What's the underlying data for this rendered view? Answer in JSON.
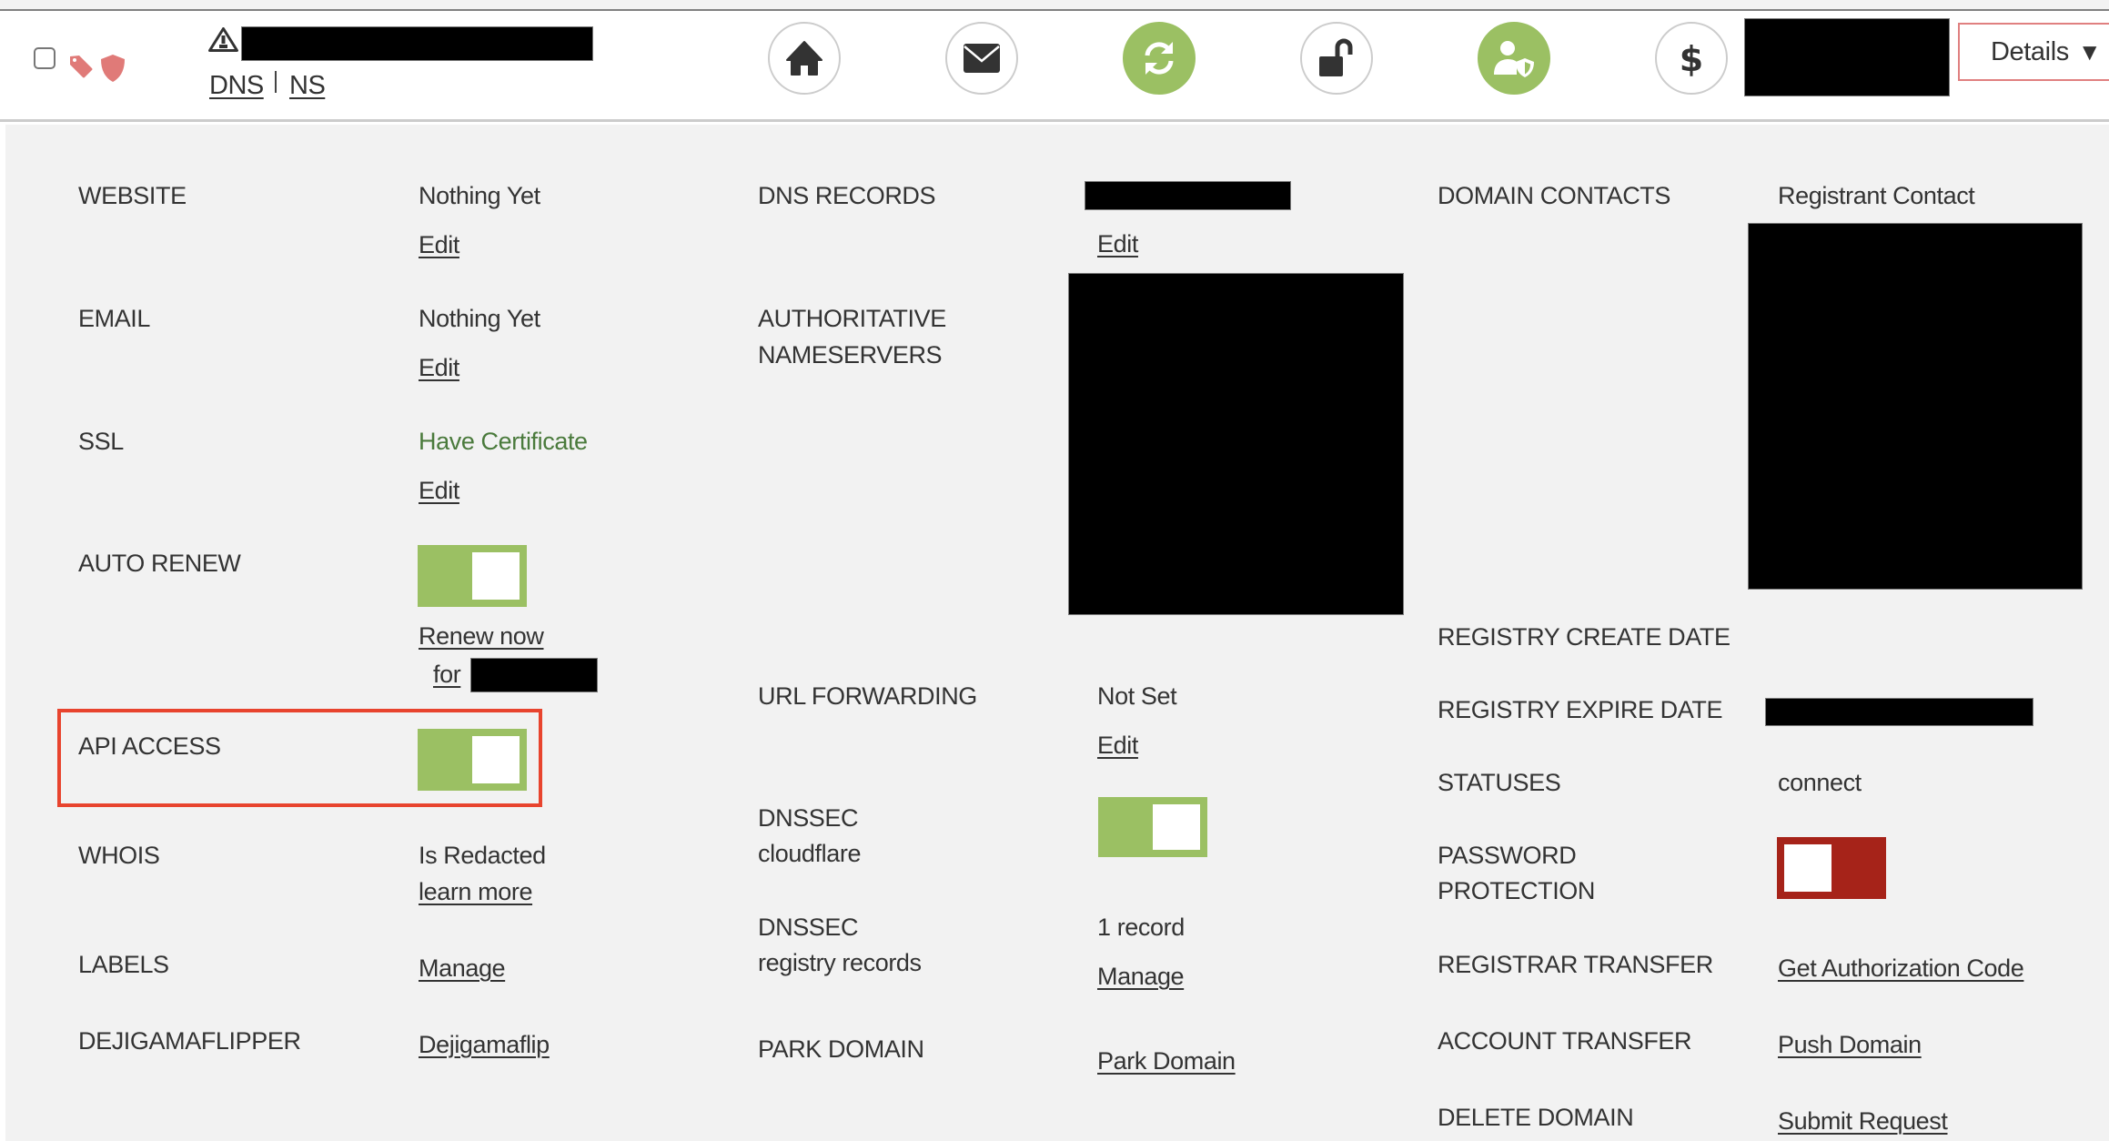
{
  "header": {
    "links": {
      "dns": "DNS",
      "ns": "NS"
    },
    "action_icons": [
      {
        "name": "home-icon",
        "label": "home",
        "active": false
      },
      {
        "name": "mail-icon",
        "label": "email",
        "active": false
      },
      {
        "name": "sync-icon",
        "label": "auto-renew",
        "active": true
      },
      {
        "name": "unlock-icon",
        "label": "lock",
        "active": false
      },
      {
        "name": "user-shield-icon",
        "label": "privacy",
        "active": true
      },
      {
        "name": "dollar-icon",
        "label": "pricing",
        "active": false
      }
    ],
    "details_label": "Details",
    "details_caret": "▼"
  },
  "colors": {
    "toggle_on": "#9bc063",
    "toggle_off": "#a62319",
    "active_icon": "#9bc063",
    "status_green_text": "#4a7a3c",
    "tag_icon": "#e07a78",
    "highlight_border": "#e8442e",
    "details_border": "#e08080"
  },
  "left": {
    "website": {
      "label": "WEBSITE",
      "value": "Nothing Yet",
      "action": "Edit"
    },
    "email": {
      "label": "EMAIL",
      "value": "Nothing Yet",
      "action": "Edit"
    },
    "ssl": {
      "label": "SSL",
      "value": "Have Certificate",
      "action": "Edit"
    },
    "auto_renew": {
      "label": "AUTO RENEW",
      "enabled": true,
      "renew_link": "Renew now",
      "for_label": "for"
    },
    "api_access": {
      "label": "API ACCESS",
      "enabled": true
    },
    "whois": {
      "label": "WHOIS",
      "value": "Is Redacted",
      "action": "learn more"
    },
    "labels": {
      "label": "LABELS",
      "action": "Manage"
    },
    "dejigamaflipper": {
      "label": "DEJIGAMAFLIPPER",
      "action": "Dejigamaflip"
    }
  },
  "middle": {
    "dns_records": {
      "label": "DNS RECORDS",
      "action": "Edit"
    },
    "nameservers": {
      "label_line1": "AUTHORITATIVE",
      "label_line2": "NAMESERVERS"
    },
    "url_forwarding": {
      "label": "URL FORWARDING",
      "value": "Not Set",
      "action": "Edit"
    },
    "dnssec_cloudflare": {
      "label_line1": "DNSSEC",
      "label_line2": "cloudflare",
      "enabled": true
    },
    "dnssec_registry": {
      "label_line1": "DNSSEC",
      "label_line2": "registry records",
      "value": "1 record",
      "action": "Manage"
    },
    "park_domain": {
      "label": "PARK DOMAIN",
      "action": "Park Domain"
    }
  },
  "right": {
    "domain_contacts": {
      "label": "DOMAIN CONTACTS",
      "value": "Registrant Contact"
    },
    "registry_create_date": {
      "label": "REGISTRY CREATE DATE"
    },
    "registry_expire_date": {
      "label": "REGISTRY EXPIRE DATE"
    },
    "statuses": {
      "label": "STATUSES",
      "value": "connect"
    },
    "password_protection": {
      "label_line1": "PASSWORD",
      "label_line2": "PROTECTION",
      "enabled": false
    },
    "registrar_transfer": {
      "label": "REGISTRAR TRANSFER",
      "action": "Get Authorization Code"
    },
    "account_transfer": {
      "label": "ACCOUNT TRANSFER",
      "action": "Push Domain"
    },
    "delete_domain": {
      "label": "DELETE DOMAIN",
      "action": "Submit Request"
    }
  }
}
